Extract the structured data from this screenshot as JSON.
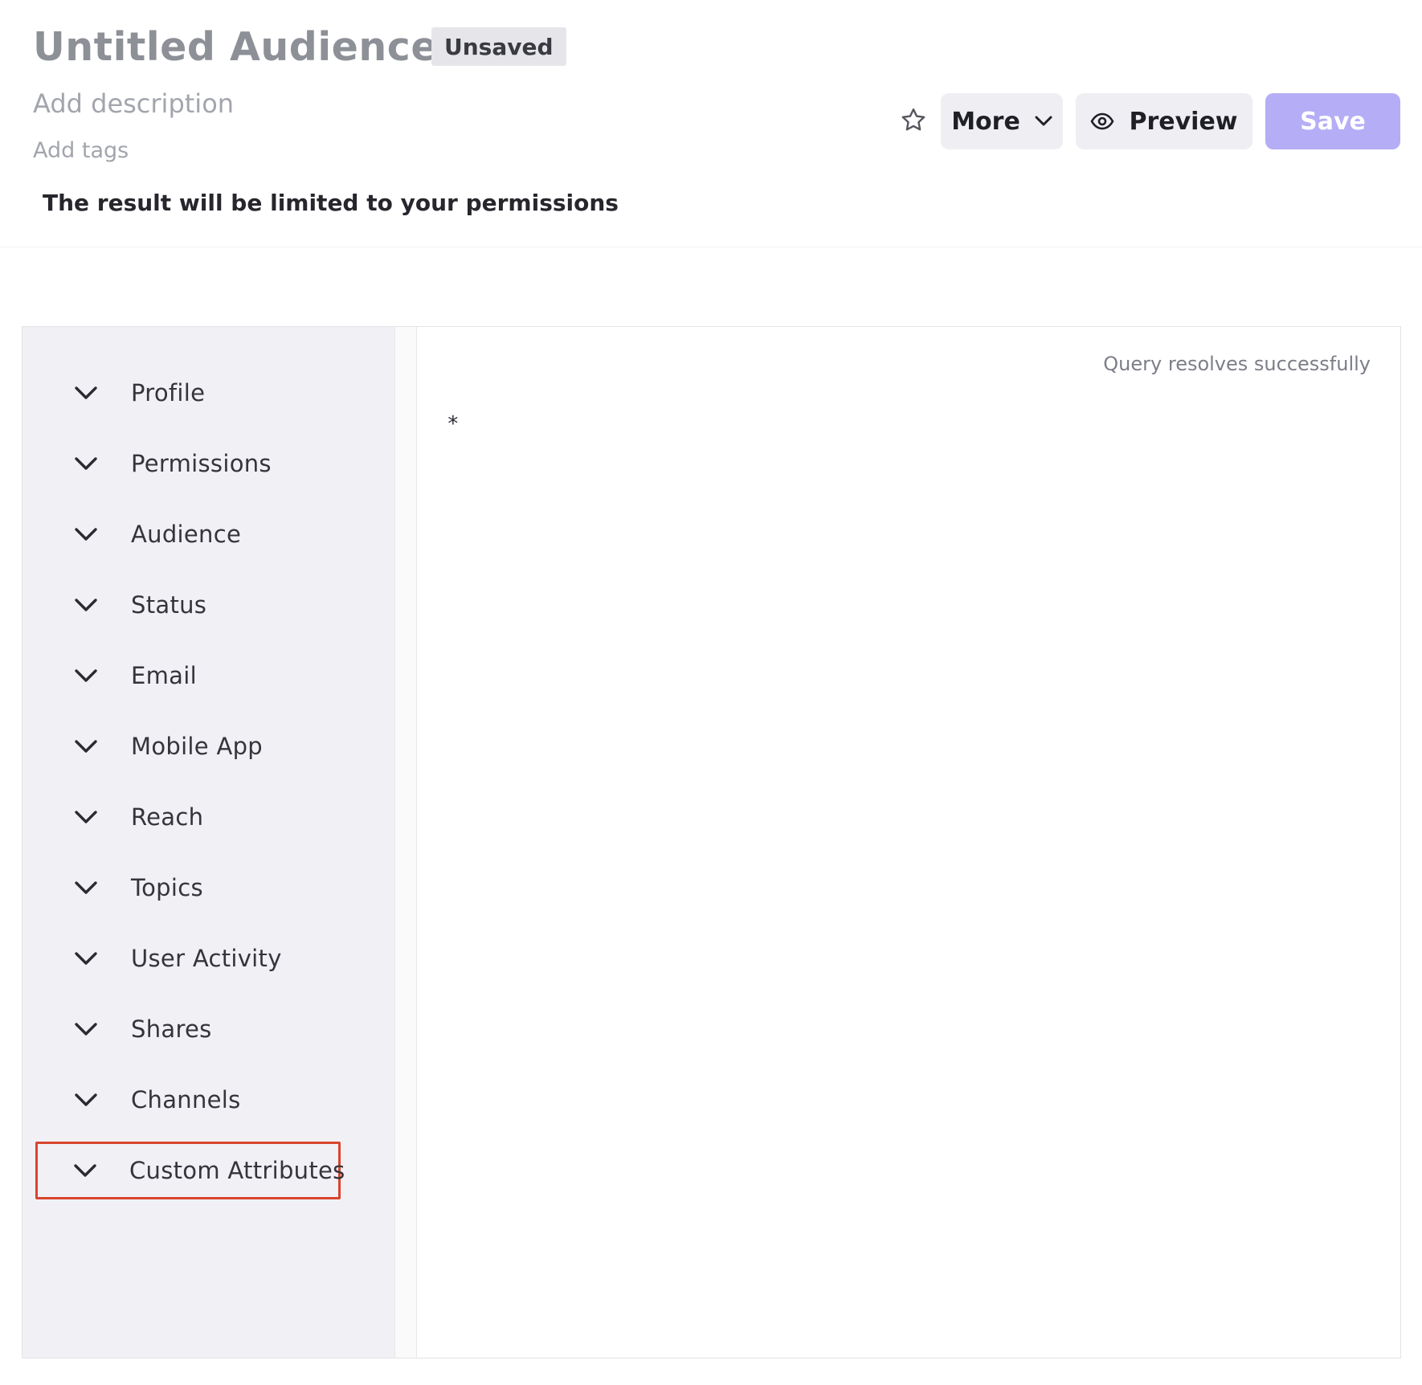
{
  "header": {
    "title": "Untitled Audience",
    "badge": "Unsaved",
    "description_placeholder": "Add description",
    "tags_placeholder": "Add tags",
    "notice": "The result will be limited to your permissions"
  },
  "toolbar": {
    "favorite_icon": "star-outline-icon",
    "more_label": "More",
    "preview_label": "Preview",
    "save_label": "Save",
    "save_color": "#b5adf6"
  },
  "sidebar": {
    "categories": [
      {
        "label": "Profile"
      },
      {
        "label": "Permissions"
      },
      {
        "label": "Audience"
      },
      {
        "label": "Status"
      },
      {
        "label": "Email"
      },
      {
        "label": "Mobile App"
      },
      {
        "label": "Reach"
      },
      {
        "label": "Topics"
      },
      {
        "label": "User Activity"
      },
      {
        "label": "Shares"
      },
      {
        "label": "Channels"
      },
      {
        "label": "Custom Attributes"
      }
    ],
    "highlighted_index": 11,
    "highlight_color": "#d8452e"
  },
  "editor": {
    "status": "Query resolves successfully",
    "query": "*"
  }
}
